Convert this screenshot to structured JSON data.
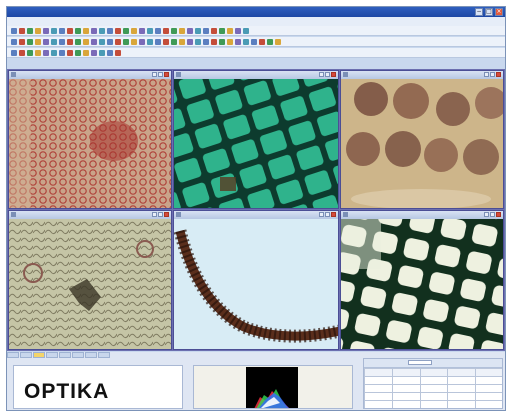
{
  "app": {
    "window_controls": [
      "−",
      "□",
      "×"
    ],
    "menus": [
      "",
      "",
      "",
      "",
      "",
      "",
      "",
      "",
      "",
      ""
    ]
  },
  "panes": [
    {
      "name": "pane-1",
      "image": "red-stained-tissue"
    },
    {
      "name": "pane-2",
      "image": "green-plant-cells"
    },
    {
      "name": "pane-3",
      "image": "brown-scales"
    },
    {
      "name": "pane-4",
      "image": "gray-tissue-section"
    },
    {
      "name": "pane-5",
      "image": "insect-leg"
    },
    {
      "name": "pane-6",
      "image": "green-cell-walls"
    }
  ],
  "bottom": {
    "logo_text": "OPTIKA",
    "table": {
      "columns": [
        "",
        "",
        "",
        "",
        ""
      ],
      "rows": [
        [
          "",
          "",
          "",
          "",
          ""
        ],
        [
          "",
          "",
          "",
          "",
          ""
        ],
        [
          "",
          "",
          "",
          "",
          ""
        ],
        [
          "",
          "",
          "",
          "",
          ""
        ]
      ]
    }
  },
  "colors": {
    "title_bar": "#2f5fbf",
    "pane_border": "#4b4e95",
    "active_tab": "#f4d46a"
  }
}
